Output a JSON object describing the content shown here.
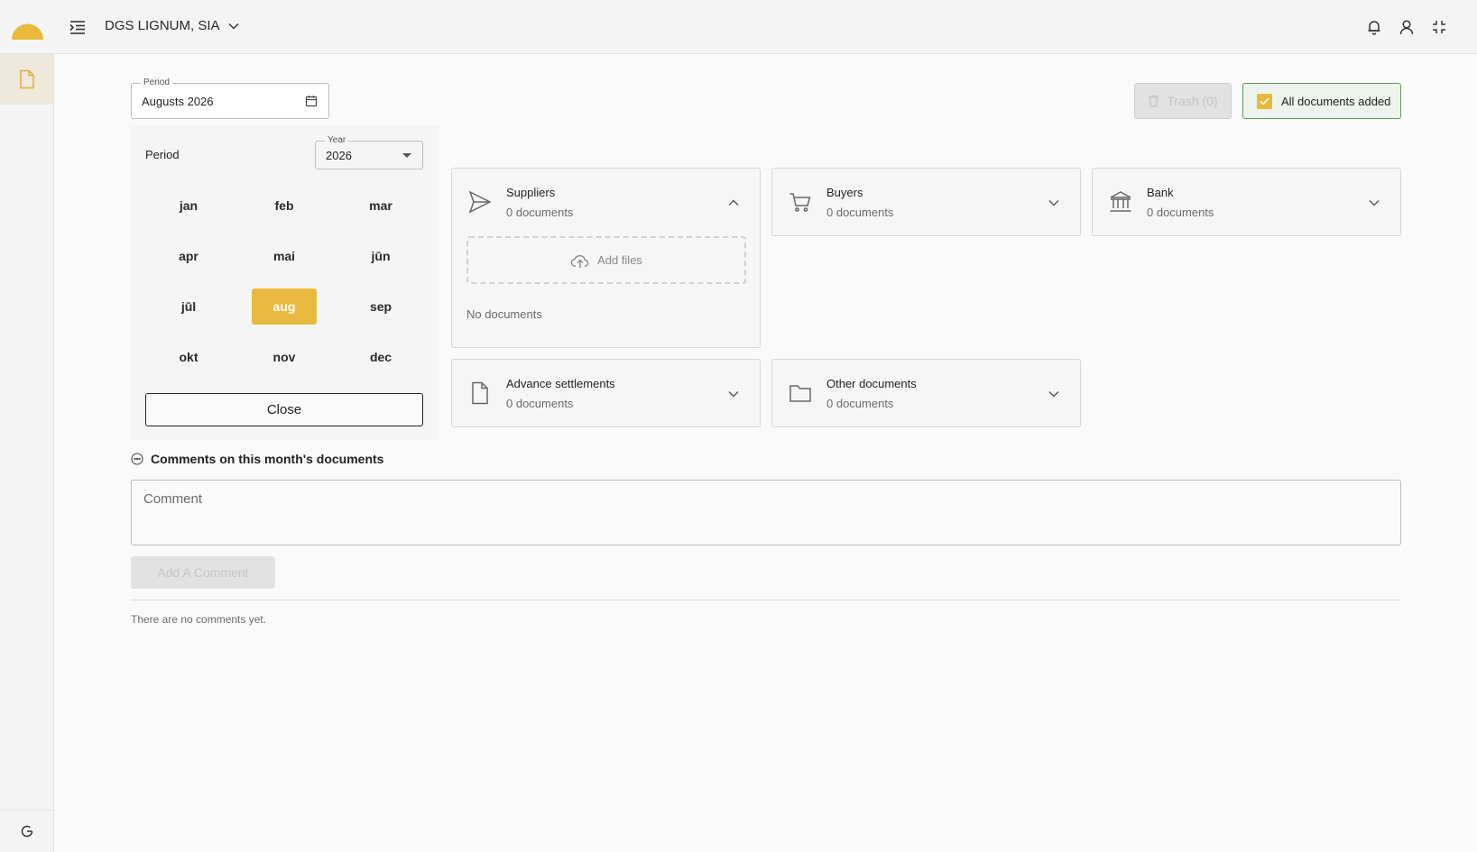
{
  "header": {
    "company_name": "DGS LIGNUM, SIA",
    "brand_color": "#e9b93c"
  },
  "period_field": {
    "legend": "Period",
    "value": "Augusts 2026"
  },
  "toolbar": {
    "trash_label": "Trash (0)",
    "all_docs_label": "All documents added",
    "all_docs_checked": true
  },
  "picker": {
    "label": "Period",
    "year_legend": "Year",
    "year_value": "2026",
    "months": [
      "jan",
      "feb",
      "mar",
      "apr",
      "mai",
      "jūn",
      "jūl",
      "aug",
      "sep",
      "okt",
      "nov",
      "dec"
    ],
    "selected_month": "aug",
    "close_label": "Close"
  },
  "cards": {
    "suppliers": {
      "title": "Suppliers",
      "count": "0 documents",
      "add_files": "Add files",
      "empty": "No documents"
    },
    "buyers": {
      "title": "Buyers",
      "count": "0 documents"
    },
    "bank": {
      "title": "Bank",
      "count": "0 documents"
    },
    "advance": {
      "title": "Advance settlements",
      "count": "0 documents"
    },
    "other": {
      "title": "Other documents",
      "count": "0 documents"
    }
  },
  "comments": {
    "title": "Comments on this month's documents",
    "placeholder": "Comment",
    "add_label": "Add A Comment",
    "empty": "There are no comments yet."
  }
}
